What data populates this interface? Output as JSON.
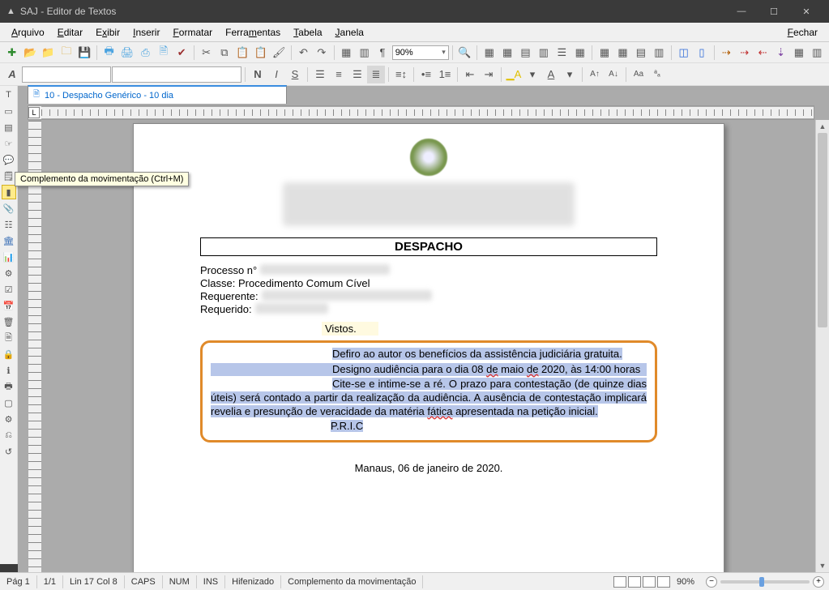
{
  "window": {
    "title": "SAJ - Editor de Textos"
  },
  "menus": {
    "arquivo": "Arquivo",
    "editar": "Editar",
    "exibir": "Exibir",
    "inserir": "Inserir",
    "formatar": "Formatar",
    "ferramentas": "Ferramentas",
    "tabela": "Tabela",
    "janela": "Janela",
    "fechar": "Fechar"
  },
  "toolbar": {
    "zoom_value": "90%",
    "font_highlight_value": "",
    "font_name_value": ""
  },
  "tab": {
    "label": "10 - Despacho Genérico - 10 dia"
  },
  "tooltip": {
    "text": "Complemento da movimentação (Ctrl+M)"
  },
  "document": {
    "title": "DESPACHO",
    "fields": {
      "processo_label": "Processo n°",
      "classe_label": "Classe:",
      "classe_value": "Procedimento Comum Cível",
      "requerente_label": "Requerente:",
      "requerido_label": "Requerido:"
    },
    "vistos": "Vistos.",
    "body": {
      "p1": "Defiro ao autor os benefícios da assistência judiciária gratuita.",
      "p2_a": "Designo audiência para o dia 08 ",
      "p2_de": "de",
      "p2_b": " maio ",
      "p2_de2": "de",
      "p2_c": " 2020, às 14:00 horas",
      "p3_a": "Cite-se e intime-se a ré. O prazo para contestação (de quinze dias úteis) será contado a partir da realização da audiência. A ausência de contestação implicará revelia e presunção de veracidade da matéria ",
      "p3_fatica": "fática",
      "p3_b": " apresentada na petição inicial.",
      "pric": "P.R.I.C"
    },
    "footer_date": "Manaus, 06 de janeiro de 2020."
  },
  "status": {
    "page": "Pág 1",
    "pages": "1/1",
    "linecol": "Lin 17  Col 8",
    "caps": "CAPS",
    "num": "NUM",
    "ins": "INS",
    "hyphen": "Hifenizado",
    "complement": "Complemento da movimentação",
    "zoom_label": "90%"
  }
}
